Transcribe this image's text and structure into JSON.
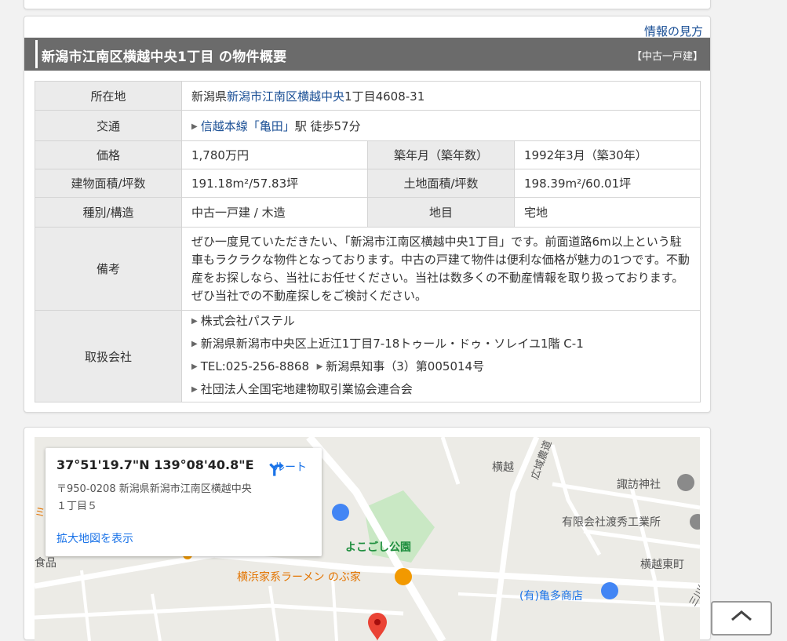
{
  "info_link": "情報の見方",
  "header": {
    "title": "新潟市江南区横越中央1丁目 の物件概要",
    "property_type": "【中古一戸建】"
  },
  "table": {
    "location": {
      "label": "所在地",
      "prefix": "新潟県",
      "link": "新潟市江南区横越中央",
      "suffix": "1丁目4608-31"
    },
    "transport": {
      "label": "交通",
      "link": "信越本線「亀田」",
      "suffix": "駅 徒歩57分"
    },
    "price": {
      "label": "価格",
      "value": "1,780万円"
    },
    "built": {
      "label": "築年月（築年数）",
      "value": "1992年3月（築30年）"
    },
    "building_area": {
      "label": "建物面積/坪数",
      "value": "191.18m²/57.83坪"
    },
    "land_area": {
      "label": "土地面積/坪数",
      "value": "198.39m²/60.01坪"
    },
    "structure": {
      "label": "種別/構造",
      "value": "中古一戸建 / 木造"
    },
    "land_category": {
      "label": "地目",
      "value": "宅地"
    },
    "remarks": {
      "label": "備考",
      "value": "ぜひ一度見ていただきたい、「新潟市江南区横越中央1丁目」です。前面道路6m以上という駐車もラクラクな物件となっております。中古の戸建て物件は便利な価格が魅力の1つです。不動産をお探しなら、当社にお任せください。当社は数多くの不動産情報を取り扱っております。ぜひ当社での不動産探しをご検討ください。"
    },
    "company": {
      "label": "取扱会社",
      "name": "株式会社パステル",
      "address": "新潟県新潟市中央区上近江1丁目7-18トゥール・ドゥ・ソレイユ1階 C-1",
      "tel": "TEL:025-256-8868",
      "license": "新潟県知事（3）第005014号",
      "association": "社団法人全国宅地建物取引業協会連合会"
    }
  },
  "map": {
    "coords": "37°51'19.7\"N 139°08'40.8\"E",
    "address": "〒950-0208 新潟県新潟市江南区横越中央１丁目５",
    "enlarge": "拡大地図を表示",
    "route": "ルート",
    "labels": {
      "yokogoshi": "横越",
      "kouiki": "広域農道",
      "suwa": "諏訪神社",
      "watahide": "有限会社渡秀工業所",
      "higashi": "横越東町",
      "park": "よこごし公園",
      "ramen": "横浜家系ラーメン のぶ家",
      "kameta": "(有)亀多商店",
      "food": "食品",
      "mikawa": "三川線",
      "edge": "ミ"
    }
  },
  "colors": {
    "header_bg": "#6b6b6b",
    "link": "#1a4f95",
    "map_link": "#1a73e8",
    "park_green": "#1e8e3e",
    "ramen_orange": "#e37400",
    "marker_red": "#ea4335"
  }
}
